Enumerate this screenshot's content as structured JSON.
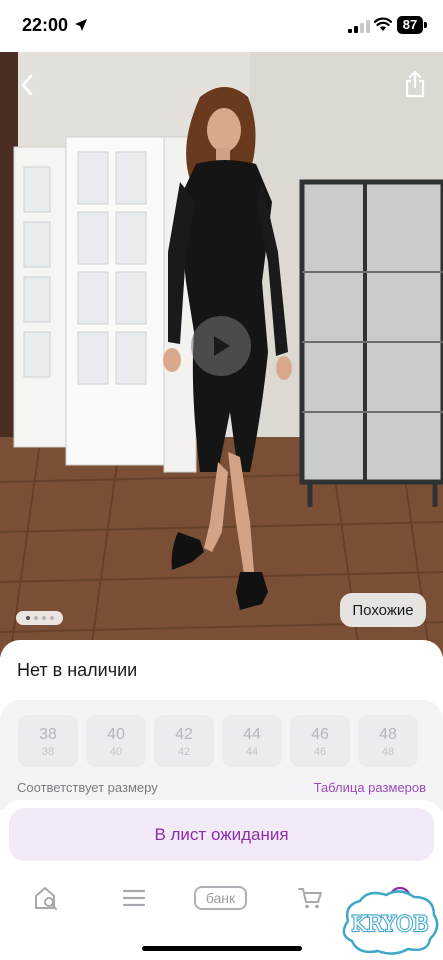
{
  "status_bar": {
    "time": "22:00",
    "battery": "87"
  },
  "product": {
    "availability": "Нет в наличии",
    "similar_label": "Похожие",
    "photo_pager": {
      "count": 4,
      "active_index": 0
    }
  },
  "sizes": {
    "items": [
      {
        "label": "38",
        "sub": "38"
      },
      {
        "label": "40",
        "sub": "40"
      },
      {
        "label": "42",
        "sub": "42"
      },
      {
        "label": "44",
        "sub": "44"
      },
      {
        "label": "46",
        "sub": "46"
      },
      {
        "label": "48",
        "sub": "48"
      }
    ],
    "fit_note": "Соответствует размеру",
    "size_table_link": "Таблица размеров"
  },
  "actions": {
    "waitlist_label": "В лист ожидания"
  },
  "tab_bar": {
    "bank_label": "банк",
    "items": [
      "search-home-icon",
      "catalog-menu-icon",
      "bank",
      "cart-icon",
      "profile-icon"
    ]
  },
  "watermark": {
    "text": "KRYOB"
  },
  "colors": {
    "accent": "#8b2fa8",
    "accent_bg": "#f2eaf6",
    "link": "#9b4db6",
    "watermark": "#3fa8c9"
  }
}
